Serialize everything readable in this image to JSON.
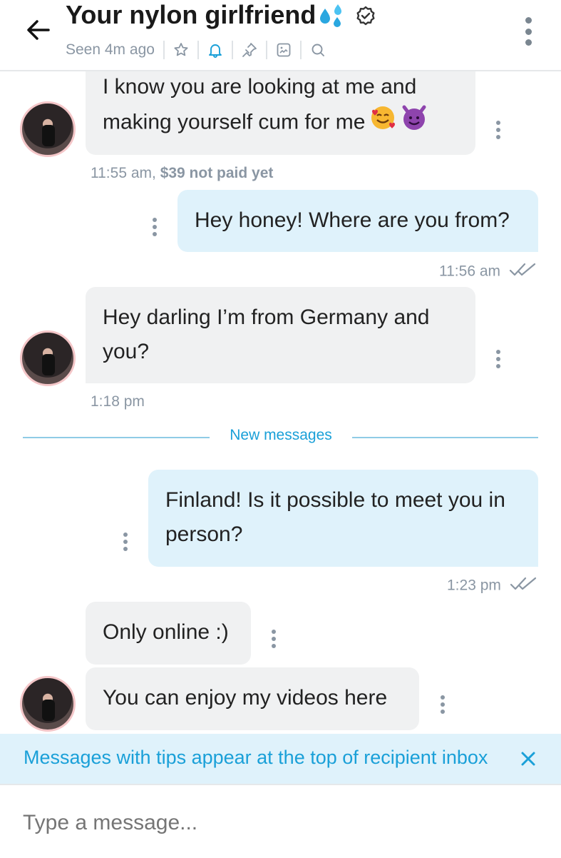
{
  "header": {
    "back_icon": "arrow-left-icon",
    "title": "Your nylon girlfriend",
    "title_icons": [
      "droplets-icon",
      "verified-badge-icon"
    ],
    "seen": "Seen 4m ago",
    "actions": [
      "star-icon",
      "bell-icon",
      "pin-icon",
      "gallery-icon",
      "search-icon"
    ],
    "menu_icon": "more-vertical-icon",
    "accent_color": "#1aa0d8"
  },
  "messages": [
    {
      "id": "m1",
      "direction": "in",
      "text": "I know you are looking at me and making yourself cum for me",
      "emojis": [
        "smiling-face-with-hearts-emoji",
        "smiling-face-with-horns-emoji"
      ],
      "time": "11:55 am,",
      "price_note": "$39 not paid yet"
    },
    {
      "id": "m2",
      "direction": "out",
      "text": "Hey honey! Where are you from?",
      "time": "11:56 am",
      "status": "read"
    },
    {
      "id": "m3",
      "direction": "in",
      "text": "Hey darling I’m from Germany and you?",
      "time": "1:18 pm"
    },
    {
      "id": "m4",
      "direction": "out",
      "text": "Finland! Is it possible to meet you in person?",
      "time": "1:23 pm",
      "status": "read"
    },
    {
      "id": "m5",
      "direction": "in",
      "text": "Only online :)"
    },
    {
      "id": "m6",
      "direction": "in",
      "text": "You can enjoy my videos here"
    }
  ],
  "divider": {
    "label": "New messages"
  },
  "tip_banner": {
    "text": "Messages with tips appear at the top of recipient inbox",
    "close_icon": "close-icon"
  },
  "composer": {
    "placeholder": "Type a message..."
  }
}
